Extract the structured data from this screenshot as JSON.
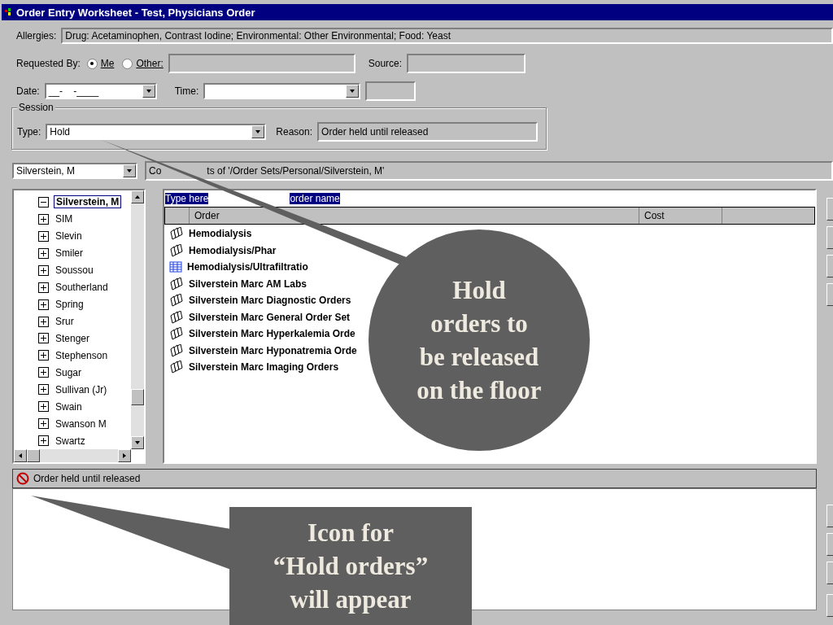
{
  "window": {
    "title": "Order Entry Worksheet - Test, Physicians Order"
  },
  "allergies": {
    "label": "Allergies:",
    "value": "Drug: Acetaminophen, Contrast Iodine; Environmental: Other Environmental; Food: Yeast"
  },
  "requested_by": {
    "label": "Requested By:",
    "options": [
      {
        "label": "Me",
        "selected": true
      },
      {
        "label": "Other:",
        "selected": false
      }
    ],
    "source_label": "Source:"
  },
  "date": {
    "label": "Date:",
    "value": "__-    -____",
    "time_label": "Time:"
  },
  "session": {
    "title": "Session",
    "type_label": "Type:",
    "type_value": "Hold",
    "reason_label": "Reason:",
    "reason_value": "Order held until released"
  },
  "folder": {
    "value": "Silverstein, M",
    "contents_parts": [
      "Co",
      "ts of '/Order Sets/Personal/Silverstein, M'"
    ]
  },
  "tree": [
    {
      "label": "Silverstein, M",
      "expanded": true,
      "selected": true
    },
    {
      "label": "SIM",
      "expanded": false,
      "selected": false
    },
    {
      "label": "Slevin",
      "expanded": false,
      "selected": false
    },
    {
      "label": "Smiler",
      "expanded": false,
      "selected": false
    },
    {
      "label": "Soussou",
      "expanded": false,
      "selected": false
    },
    {
      "label": "Southerland",
      "expanded": false,
      "selected": false
    },
    {
      "label": "Spring",
      "expanded": false,
      "selected": false
    },
    {
      "label": "Srur",
      "expanded": false,
      "selected": false
    },
    {
      "label": "Stenger",
      "expanded": false,
      "selected": false
    },
    {
      "label": "Stephenson",
      "expanded": false,
      "selected": false
    },
    {
      "label": "Sugar",
      "expanded": false,
      "selected": false
    },
    {
      "label": "Sullivan (Jr)",
      "expanded": false,
      "selected": false
    },
    {
      "label": "Swain",
      "expanded": false,
      "selected": false
    },
    {
      "label": "Swanson M",
      "expanded": false,
      "selected": false
    },
    {
      "label": "Swartz",
      "expanded": false,
      "selected": false
    }
  ],
  "search_parts": [
    "Type here",
    "order name"
  ],
  "columns": [
    "Order",
    "Cost"
  ],
  "orders": [
    {
      "kind": "set",
      "label": "Hemodialysis"
    },
    {
      "kind": "set",
      "label": "Hemodialysis/Phar"
    },
    {
      "kind": "table",
      "label": "Hemodialysis/Ultrafiltratio"
    },
    {
      "kind": "set",
      "label": "Silverstein Marc AM Labs"
    },
    {
      "kind": "set",
      "label": "Silverstein Marc Diagnostic Orders"
    },
    {
      "kind": "set",
      "label": "Silverstein Marc General Order Set"
    },
    {
      "kind": "set",
      "label": "Silverstein Marc Hyperkalemia Orde"
    },
    {
      "kind": "set",
      "label": "Silverstein Marc Hyponatremia Orde"
    },
    {
      "kind": "set",
      "label": "Silverstein Marc Imaging Orders"
    }
  ],
  "status": {
    "text": "Order held until released"
  },
  "callouts": [
    {
      "kind": "circle",
      "lines": [
        "Hold",
        "orders to",
        "be released",
        "on the floor"
      ]
    },
    {
      "kind": "box",
      "lines": [
        "Icon for",
        "“Hold orders”",
        "will appear"
      ]
    }
  ]
}
